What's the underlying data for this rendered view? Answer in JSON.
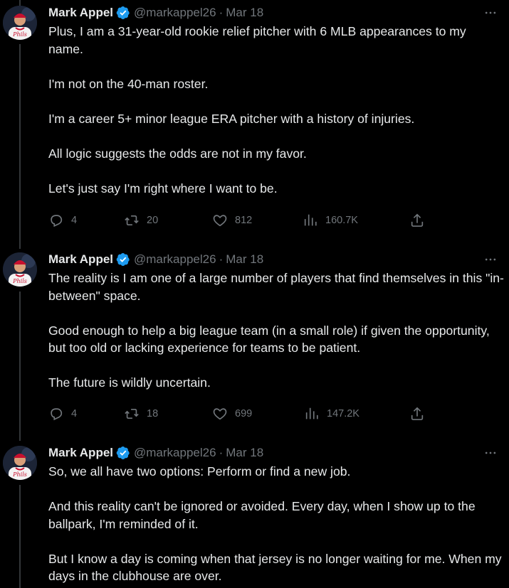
{
  "tweets": [
    {
      "name": "Mark Appel",
      "handle": "@markappel26",
      "date": "Mar 18",
      "paragraphs": [
        "Plus, I am a 31-year-old rookie relief pitcher with 6 MLB appearances to my name.",
        "I'm not on the 40-man roster.",
        "I'm a career 5+ minor league ERA pitcher with a history of injuries.",
        "All logic suggests the odds are not in my favor.",
        "Let's just say I'm right where I want to be."
      ],
      "replies": "4",
      "retweets": "20",
      "likes": "812",
      "views": "160.7K"
    },
    {
      "name": "Mark Appel",
      "handle": "@markappel26",
      "date": "Mar 18",
      "paragraphs": [
        "The reality is I am one of a large number of players that find themselves in this \"in-between\" space.",
        "Good enough to help a big league team (in a small role) if given the opportunity, but too old or lacking experience for teams to be patient.",
        "The future is wildly uncertain."
      ],
      "replies": "4",
      "retweets": "18",
      "likes": "699",
      "views": "147.2K"
    },
    {
      "name": "Mark Appel",
      "handle": "@markappel26",
      "date": "Mar 18",
      "paragraphs": [
        "So, we all have two options: Perform or find a new job.",
        "And this reality can't be ignored or avoided. Every day, when I show up to the ballpark, I'm reminded of it.",
        "But I know a day is coming when that jersey is no longer waiting for me. When my days in the clubhouse are over."
      ]
    }
  ],
  "icons": {
    "verified": "verified-badge-icon",
    "more": "more-dots-icon",
    "reply": "reply-icon",
    "retweet": "retweet-icon",
    "like": "heart-icon",
    "views": "views-bar-chart-icon",
    "share": "share-icon"
  },
  "colors": {
    "background": "#000000",
    "text": "#e7e9ea",
    "muted": "#71767b",
    "verified": "#1d9bf0",
    "thread_line": "#333639"
  }
}
